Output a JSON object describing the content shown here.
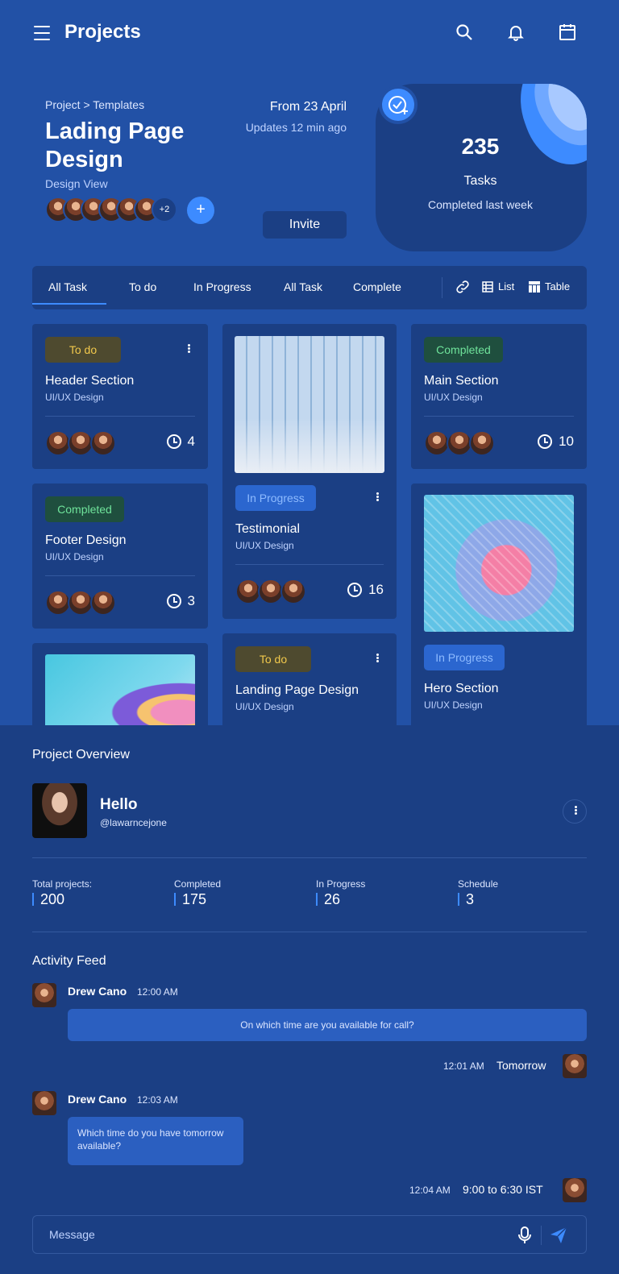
{
  "header": {
    "title": "Projects"
  },
  "hero": {
    "breadcrumb": "Project > Templates",
    "title": "Lading Page Design",
    "subtitle": "Design View",
    "extra_members": "+2",
    "add_label": "+",
    "from": "From 23 April",
    "updates": "Updates 12 min ago",
    "invite_label": "Invite"
  },
  "stats": {
    "value": "235",
    "label": "Tasks",
    "caption": "Completed last week"
  },
  "tabs": [
    "All Task",
    "To do",
    "In Progress",
    "All Task",
    "Complete"
  ],
  "views": {
    "list": "List",
    "table": "Table"
  },
  "cards": [
    {
      "badge": "To do",
      "title": "Header Section",
      "subtitle": "UI/UX Design",
      "count": "4"
    },
    {
      "badge": "In Progress",
      "title": "Testimonial",
      "subtitle": "UI/UX Design",
      "count": "16"
    },
    {
      "badge": "Completed",
      "title": "Main Section",
      "subtitle": "UI/UX Design",
      "count": "10"
    },
    {
      "badge": "Completed",
      "title": "Footer Design",
      "subtitle": "UI/UX Design",
      "count": "3"
    },
    {
      "badge": "To do",
      "title": "Landing Page Design",
      "subtitle": "UI/UX Design"
    },
    {
      "badge": "In Progress",
      "title": "Hero Section",
      "subtitle": "UI/UX Design"
    }
  ],
  "overview": {
    "title": "Project Overview",
    "greeting": "Hello",
    "handle": "@lawarncejone",
    "kpis": [
      {
        "label": "Total projects:",
        "value": "200"
      },
      {
        "label": "Completed",
        "value": "175"
      },
      {
        "label": "In Progress",
        "value": "26"
      },
      {
        "label": "Schedule",
        "value": "3"
      }
    ]
  },
  "feed": {
    "title": "Activity Feed",
    "items": [
      {
        "name": "Drew Cano",
        "time": "12:00 AM",
        "text": "On which time are you available for call?"
      },
      {
        "time": "12:01 AM",
        "text": "Tomorrow"
      },
      {
        "name": "Drew Cano",
        "time": "12:03 AM",
        "text": "Which time do you have tomorrow available?"
      },
      {
        "time": "12:04 AM",
        "text": "9:00 to 6:30 IST"
      }
    ]
  },
  "message": {
    "placeholder": "Message"
  }
}
